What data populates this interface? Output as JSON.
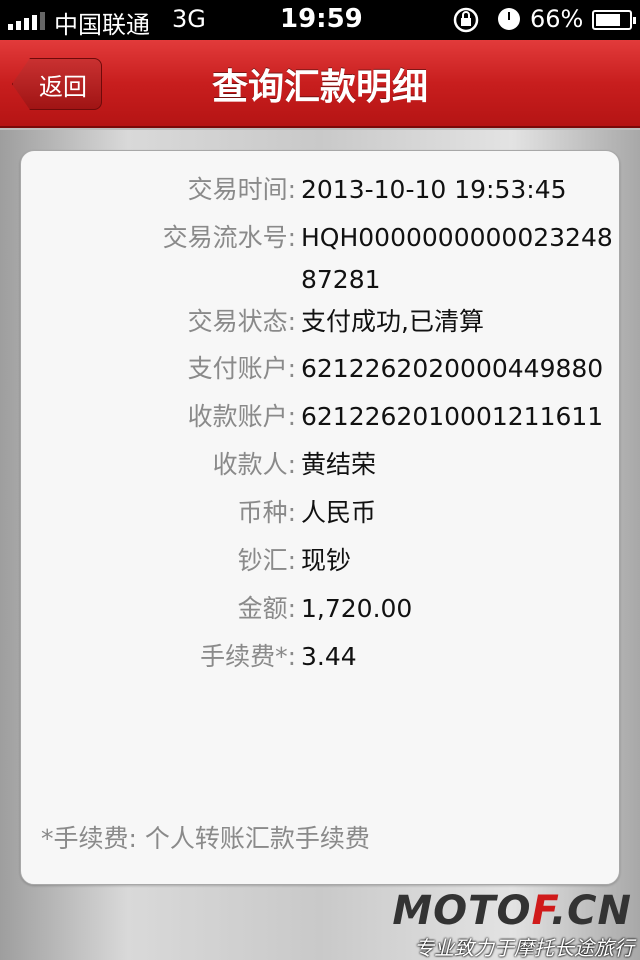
{
  "status_bar": {
    "carrier": "中国联通",
    "network": "3G",
    "time": "19:59",
    "battery": "66%"
  },
  "nav": {
    "back_label": "返回",
    "title": "查询汇款明细"
  },
  "details": [
    {
      "label": "交易时间:",
      "value": "2013-10-10 19:53:45"
    },
    {
      "label": "交易流水号:",
      "value": "HQH000000000002324887281"
    },
    {
      "label": "交易状态:",
      "value": "支付成功,已清算"
    },
    {
      "label": "支付账户:",
      "value": "6212262020000449880"
    },
    {
      "label": "收款账户:",
      "value": "6212262010001211611"
    },
    {
      "label": "收款人:",
      "value": "黄结荣"
    },
    {
      "label": "币种:",
      "value": "人民币"
    },
    {
      "label": "钞汇:",
      "value": "现钞"
    },
    {
      "label": "金额:",
      "value": "1,720.00"
    },
    {
      "label": "手续费*:",
      "value": "3.44"
    }
  ],
  "footnote": "*手续费: 个人转账汇款手续费",
  "watermark": {
    "logo_a": "MOTO",
    "logo_b": "F",
    "logo_c": ".CN",
    "slogan": "专业致力于摩托长途旅行"
  },
  "colors": {
    "nav_red": "#c81e1e",
    "label_gray": "#8a8a8a"
  }
}
